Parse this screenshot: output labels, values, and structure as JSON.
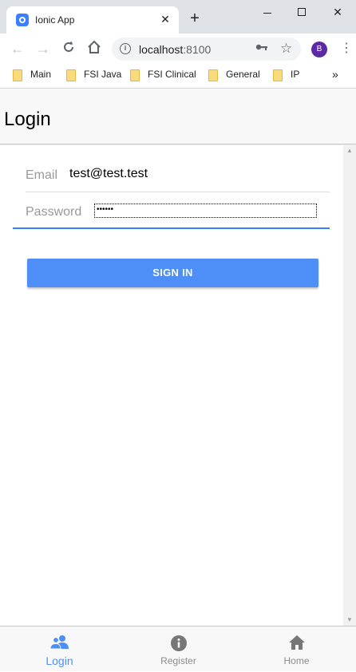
{
  "browser": {
    "tab_title": "Ionic App",
    "tab_close": "✕",
    "new_tab": "+",
    "url_host": "localhost",
    "url_port": ":8100",
    "profile_initial": "B",
    "bookmarks": [
      {
        "label": "Main"
      },
      {
        "label": "FSI Java"
      },
      {
        "label": "FSI Clinical"
      },
      {
        "label": "General"
      },
      {
        "label": "IP"
      }
    ],
    "bookmarks_more": "»"
  },
  "app": {
    "page_title": "Login",
    "email_label": "Email",
    "email_value": "test@test.test",
    "password_label": "Password",
    "password_mask": "••••••",
    "signin_label": "SIGN IN"
  },
  "tabbar": {
    "login_label": "Login",
    "register_label": "Register",
    "home_label": "Home",
    "active_color": "#4e8ef7",
    "inactive_color": "#8c8c8c"
  },
  "colors": {
    "primary": "#3880ff",
    "button": "#4e8ef7",
    "profile": "#5d2aa3"
  }
}
